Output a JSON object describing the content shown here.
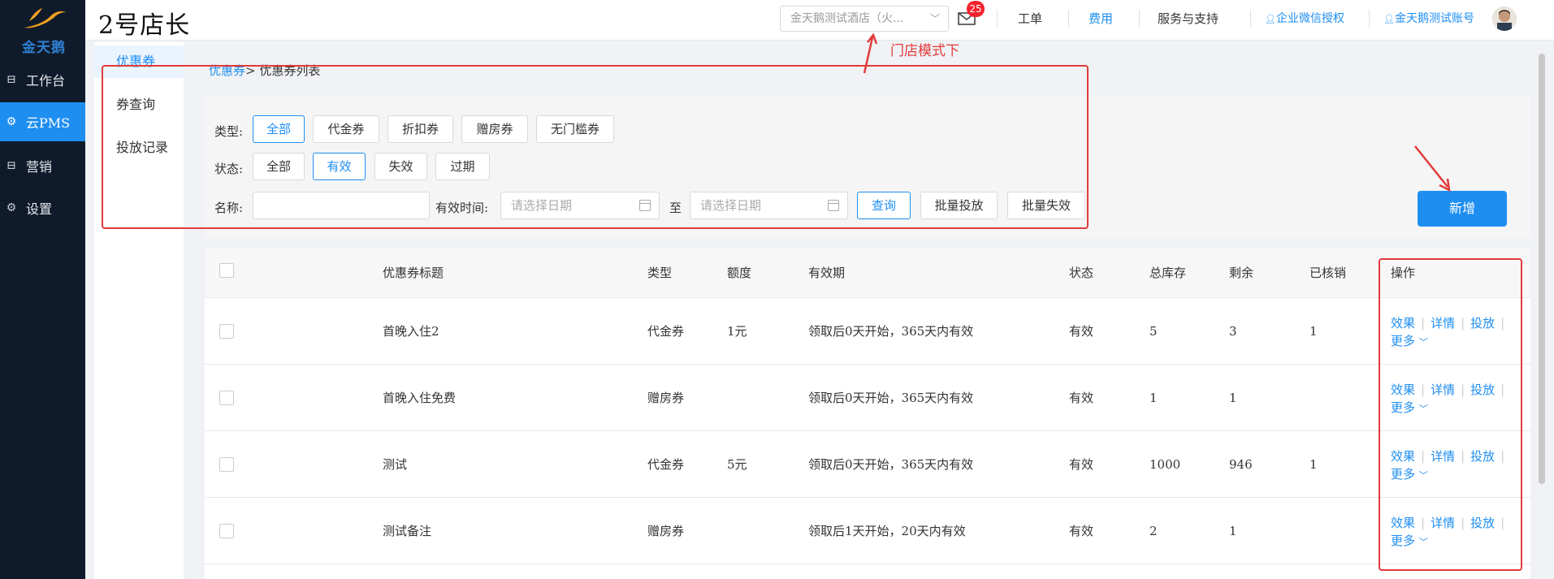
{
  "brand": {
    "logo_text": "金天鹅",
    "title": "2号店长",
    "logo_color": "#f0a020"
  },
  "leftnav": {
    "items": [
      {
        "label": "工作台",
        "icon": "workbench-icon"
      },
      {
        "label": "云PMS",
        "icon": "gear-icon"
      },
      {
        "label": "营销",
        "icon": "marketing-icon"
      },
      {
        "label": "设置",
        "icon": "settings-icon"
      }
    ],
    "active_index": 1
  },
  "header": {
    "hotel_select_value": "金天鹅测试酒店（火...",
    "notification_count": "25",
    "nav": [
      "工单",
      "费用",
      "服务与支持",
      "企业微信授权",
      "金天鹅测试账号"
    ]
  },
  "subnav": {
    "items": [
      "优惠券",
      "券查询",
      "投放记录"
    ],
    "active_index": 0
  },
  "breadcrumb": {
    "link": "优惠券",
    "current": "> 优惠券列表"
  },
  "filters": {
    "type_label": "类型:",
    "type_options": [
      "全部",
      "代金券",
      "折扣券",
      "赠房券",
      "无门槛券"
    ],
    "type_selected": "全部",
    "status_label": "状态:",
    "status_options": [
      "全部",
      "有效",
      "失效",
      "过期"
    ],
    "status_selected": "有效",
    "name_label": "名称:",
    "name_value": "",
    "valid_time_label": "有效时间:",
    "date_start_placeholder": "请选择日期",
    "date_to": "至",
    "date_end_placeholder": "请选择日期",
    "query_button": "查询",
    "batch_issue_button": "批量投放",
    "batch_invalidate_button": "批量失效"
  },
  "new_button": "新增",
  "table": {
    "headers": [
      "优惠券标题",
      "类型",
      "额度",
      "有效期",
      "状态",
      "总库存",
      "剩余",
      "已核销",
      "操作"
    ],
    "rows": [
      {
        "title": "首晚入住2",
        "type": "代金券",
        "amount": "1元",
        "validity": "领取后0天开始，365天内有效",
        "status": "有效",
        "stock": "5",
        "remaining": "3",
        "used": "1"
      },
      {
        "title": "首晚入住免费",
        "type": "赠房券",
        "amount": "",
        "validity": "领取后0天开始，365天内有效",
        "status": "有效",
        "stock": "1",
        "remaining": "1",
        "used": ""
      },
      {
        "title": "测试",
        "type": "代金券",
        "amount": "5元",
        "validity": "领取后0天开始，365天内有效",
        "status": "有效",
        "stock": "1000",
        "remaining": "946",
        "used": "1"
      },
      {
        "title": "测试备注",
        "type": "赠房券",
        "amount": "",
        "validity": "领取后1天开始，20天内有效",
        "status": "有效",
        "stock": "2",
        "remaining": "1",
        "used": ""
      }
    ],
    "actions": {
      "effect": "效果",
      "detail": "详情",
      "issue": "投放",
      "more": "更多"
    }
  },
  "annotation": {
    "store_mode_note": "门店模式下",
    "color": "#e23b3b"
  },
  "colors": {
    "primary": "#1f8ef1",
    "nav_bg": "#0f1b2b",
    "badge": "#f5222d"
  }
}
